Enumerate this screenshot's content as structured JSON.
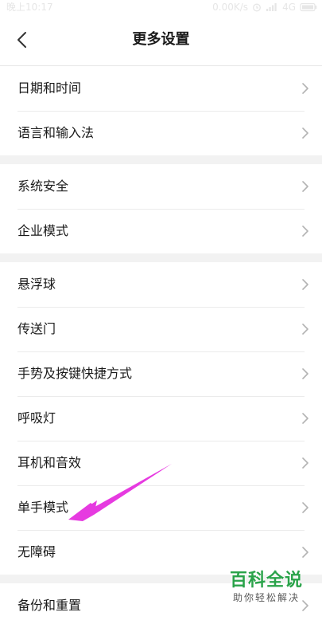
{
  "status_bar": {
    "time": "晚上10:17",
    "network_speed": "0.00K/s",
    "network_type": "4G",
    "icons": [
      "alarm-icon",
      "signal-icon",
      "battery-icon"
    ]
  },
  "header": {
    "title": "更多设置",
    "back_icon": "chevron-left-icon"
  },
  "groups": [
    {
      "items": [
        "日期和时间",
        "语言和输入法"
      ]
    },
    {
      "items": [
        "系统安全",
        "企业模式"
      ]
    },
    {
      "items": [
        "悬浮球",
        "传送门",
        "手势及按键快捷方式",
        "呼吸灯",
        "耳机和音效",
        "单手模式",
        "无障碍"
      ]
    },
    {
      "items": [
        "备份和重置"
      ]
    }
  ],
  "annotation": {
    "arrow_color": "#e63ae0",
    "points_to": "单手模式"
  },
  "watermark": {
    "main": "百科全说",
    "sub": "助你轻松解决"
  },
  "colors": {
    "group_gap": "#f2f2f2",
    "chevron": "#b3b3b3",
    "watermark_green": "#2aa34a"
  }
}
